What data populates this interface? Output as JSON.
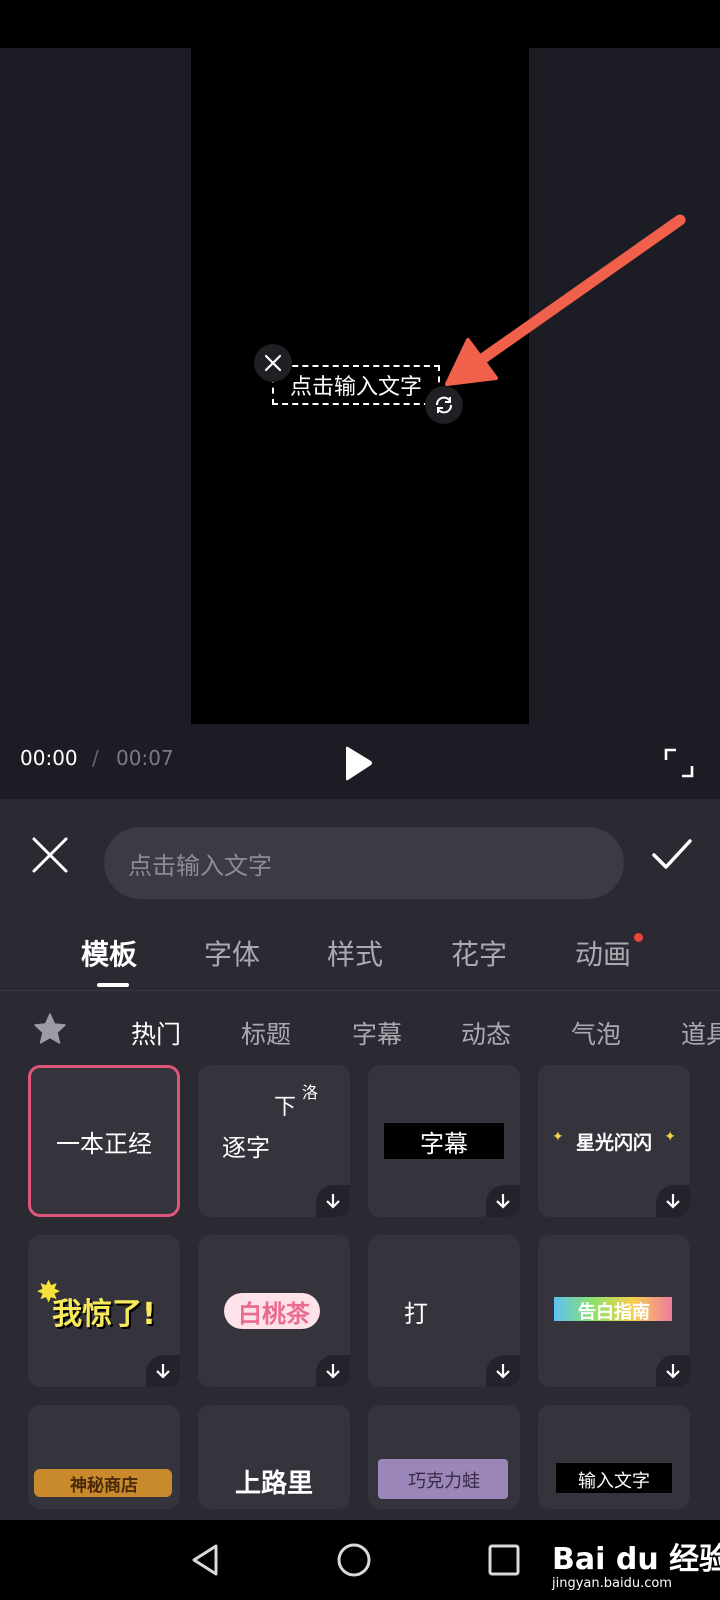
{
  "preview": {
    "overlay_text": "点击输入文字"
  },
  "playback": {
    "current_time": "00:00",
    "separator": "/",
    "total_time": "00:07"
  },
  "editor": {
    "input_placeholder": "点击输入文字",
    "main_tabs": [
      {
        "label": "模板",
        "active": true
      },
      {
        "label": "字体",
        "active": false
      },
      {
        "label": "样式",
        "active": false
      },
      {
        "label": "花字",
        "active": false
      },
      {
        "label": "动画",
        "active": false,
        "badge": "red-dot"
      }
    ],
    "sub_tabs": [
      {
        "label": "热门",
        "active": true
      },
      {
        "label": "标题",
        "active": false
      },
      {
        "label": "字幕",
        "active": false
      },
      {
        "label": "动态",
        "active": false
      },
      {
        "label": "气泡",
        "active": false
      },
      {
        "label": "道具",
        "active": false
      }
    ],
    "templates": [
      {
        "label": "一本正经",
        "selected": true
      },
      {
        "label": "逐字",
        "extra": "下",
        "extra2": "洛"
      },
      {
        "label": "字幕"
      },
      {
        "label": "星光闪闪"
      },
      {
        "label": "我惊了!"
      },
      {
        "label": "白桃茶"
      },
      {
        "label": "打"
      },
      {
        "label": "告白指南"
      },
      {
        "label": "神秘商店"
      },
      {
        "label": "上路里"
      },
      {
        "label": "巧克力蛙"
      },
      {
        "label": "输入文字"
      }
    ]
  },
  "watermark": {
    "brand": "Bai du 经验",
    "url": "jingyan.baidu.com"
  },
  "colors": {
    "accent_selected": "#e0557a",
    "arrow": "#f0604b",
    "badge": "#e8453c",
    "panel_bg": "#2b2a33"
  }
}
